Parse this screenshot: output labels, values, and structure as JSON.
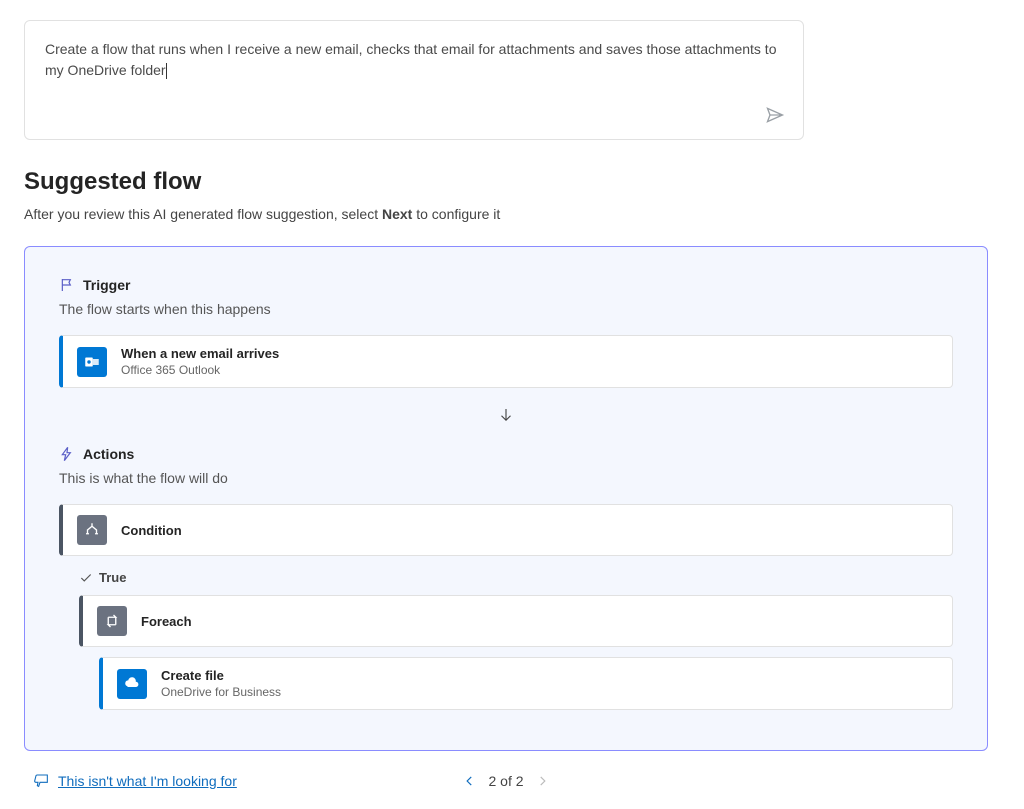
{
  "prompt": {
    "text": "Create a flow that runs when I receive a new email, checks that email for attachments and saves those attachments to my OneDrive folder"
  },
  "heading": "Suggested flow",
  "subheading_before": "After you review this AI generated flow suggestion, select ",
  "subheading_bold": "Next",
  "subheading_after": " to configure it",
  "trigger": {
    "header": "Trigger",
    "desc": "The flow starts when this happens",
    "step": {
      "title": "When a new email arrives",
      "subtitle": "Office 365 Outlook"
    }
  },
  "actions": {
    "header": "Actions",
    "desc": "This is what the flow will do",
    "condition": {
      "title": "Condition"
    },
    "true_label": "True",
    "foreach": {
      "title": "Foreach"
    },
    "create_file": {
      "title": "Create file",
      "subtitle": "OneDrive for Business"
    }
  },
  "footer": {
    "feedback": "This isn't what I'm looking for",
    "pager": "2 of 2"
  }
}
